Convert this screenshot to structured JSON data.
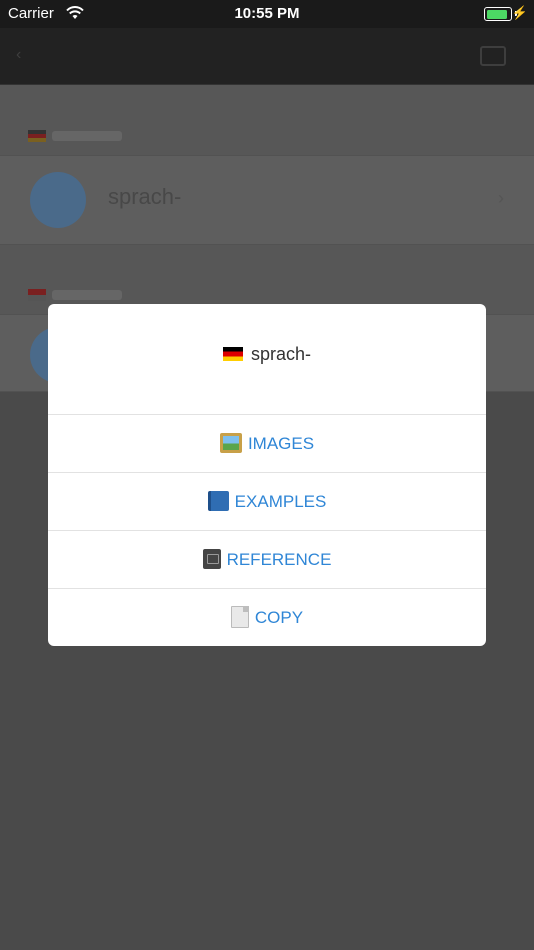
{
  "status_bar": {
    "carrier": "Carrier",
    "time": "10:55 PM",
    "battery_level": 1.0,
    "battery_color": "#4cd964"
  },
  "background": {
    "word": "sprach-"
  },
  "popup": {
    "title": "sprach-",
    "flag_icon": "german-flag-icon",
    "accent_color": "#2f86d6",
    "actions": [
      {
        "label": "IMAGES",
        "icon": "framed-picture-icon"
      },
      {
        "label": "EXAMPLES",
        "icon": "blue-book-icon"
      },
      {
        "label": "REFERENCE",
        "icon": "ledger-icon"
      },
      {
        "label": "COPY",
        "icon": "page-icon"
      }
    ]
  }
}
